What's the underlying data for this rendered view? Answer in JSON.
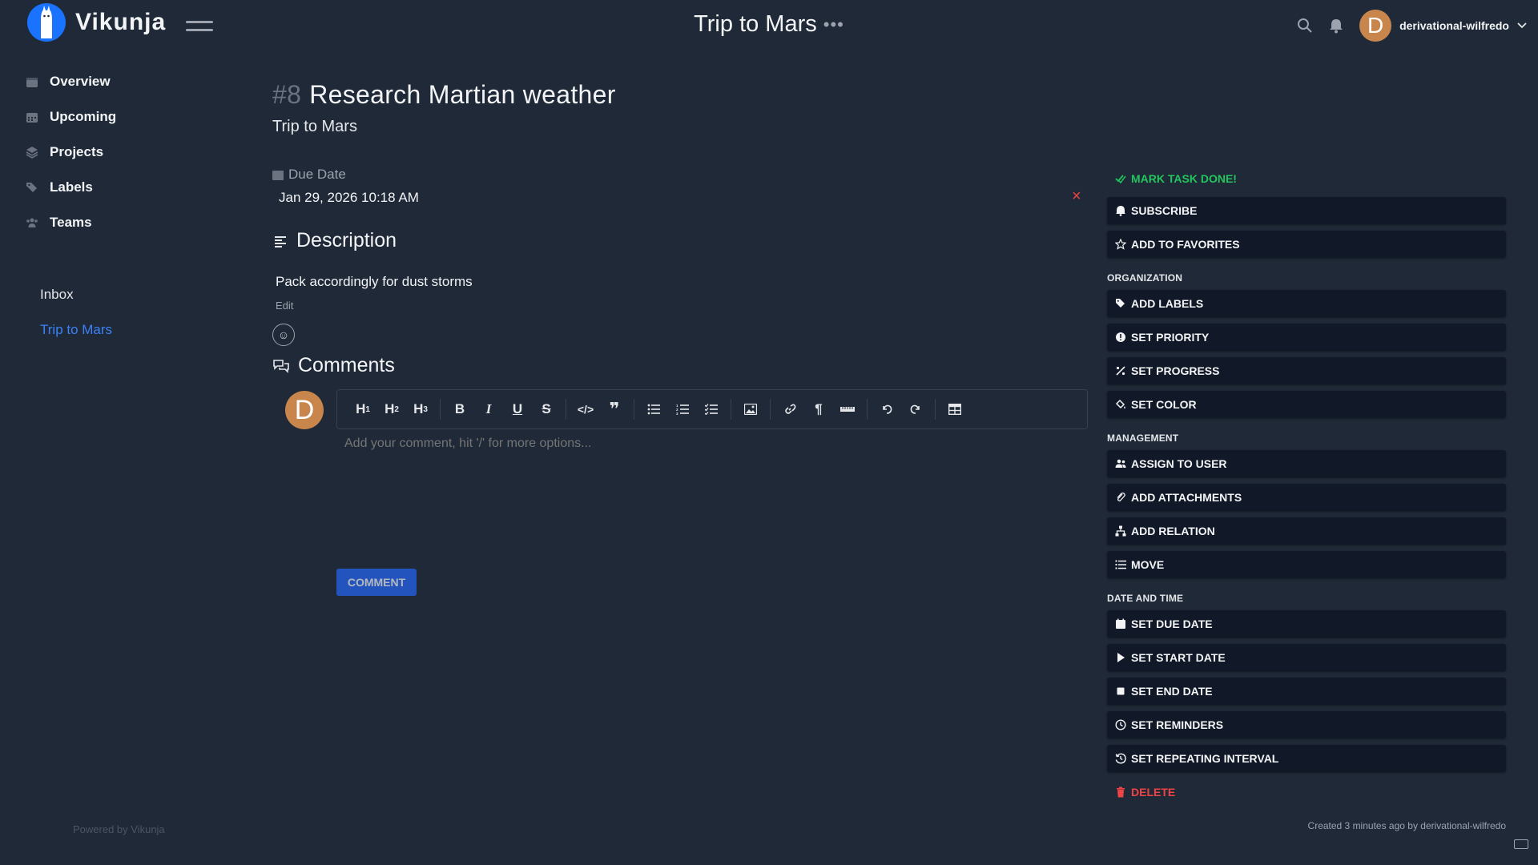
{
  "app": {
    "name": "Vikunja"
  },
  "header": {
    "project_title": "Trip to Mars",
    "more_dots": "•••",
    "username": "derivational-wilfredo",
    "avatar_letter": "D"
  },
  "sidebar": {
    "nav": [
      {
        "label": "Overview",
        "icon": "calendar-icon"
      },
      {
        "label": "Upcoming",
        "icon": "calendar-grid-icon"
      },
      {
        "label": "Projects",
        "icon": "layers-icon"
      },
      {
        "label": "Labels",
        "icon": "tags-icon"
      },
      {
        "label": "Teams",
        "icon": "users-icon"
      }
    ],
    "projects": [
      {
        "label": "Inbox",
        "active": false
      },
      {
        "label": "Trip to Mars",
        "active": true
      }
    ],
    "powered_by": "Powered by Vikunja"
  },
  "task": {
    "number": "#8",
    "title": "Research Martian weather",
    "project": "Trip to Mars",
    "due_label": "Due Date",
    "due_value": "Jan 29, 2026 10:18 AM",
    "clear": "×",
    "description_heading": "Description",
    "description_text": "Pack accordingly for dust storms",
    "edit_label": "Edit",
    "comments_heading": "Comments",
    "comment_placeholder": "Add your comment, hit '/' for more options...",
    "comment_button": "COMMENT",
    "commenter_letter": "D"
  },
  "panel": {
    "mark_done": "MARK TASK DONE!",
    "subscribe": "SUBSCRIBE",
    "favorites": "ADD TO FAVORITES",
    "org_label": "ORGANIZATION",
    "add_labels": "ADD LABELS",
    "set_priority": "SET PRIORITY",
    "set_progress": "SET PROGRESS",
    "set_color": "SET COLOR",
    "mgmt_label": "MANAGEMENT",
    "assign": "ASSIGN TO USER",
    "attachments": "ADD ATTACHMENTS",
    "relation": "ADD RELATION",
    "move": "MOVE",
    "date_label": "DATE AND TIME",
    "due_date": "SET DUE DATE",
    "start_date": "SET START DATE",
    "end_date": "SET END DATE",
    "reminders": "SET REMINDERS",
    "repeating": "SET REPEATING INTERVAL",
    "delete": "DELETE"
  },
  "footer": {
    "created": "Created 3 minutes ago by derivational-wilfredo"
  },
  "colors": {
    "background": "#1f2937",
    "accent": "#3b82f6",
    "success": "#22c55e",
    "danger": "#ef4444",
    "avatar": "#c8864c"
  }
}
